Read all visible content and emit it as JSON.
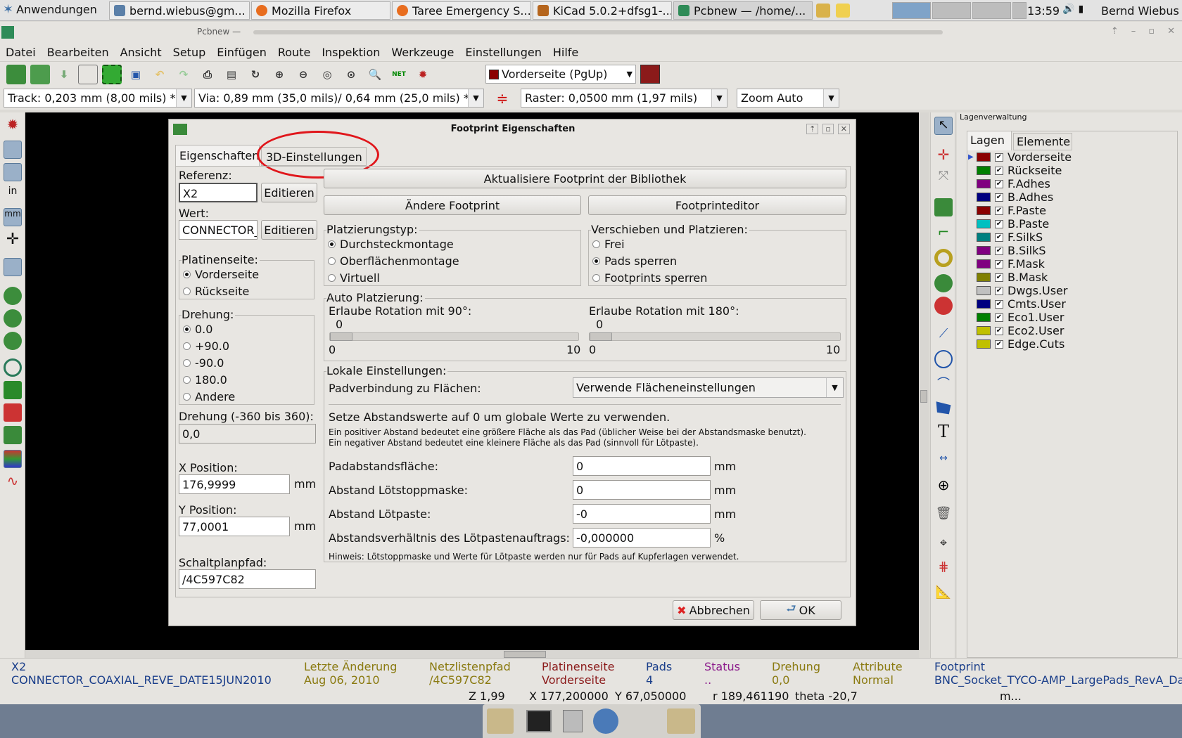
{
  "taskbar": {
    "apps_label": "Anwendungen",
    "tasks": [
      "bernd.wiebus@gm...",
      "Mozilla Firefox",
      "Taree Emergency S...",
      "KiCad 5.0.2+dfsg1-...",
      "Pcbnew — /home/..."
    ],
    "clock": "13:59",
    "user": "Bernd Wiebus"
  },
  "window": {
    "title": "Pcbnew —"
  },
  "menu": [
    "Datei",
    "Bearbeiten",
    "Ansicht",
    "Setup",
    "Einfügen",
    "Route",
    "Inspektion",
    "Werkzeuge",
    "Einstellungen",
    "Hilfe"
  ],
  "toolbar": {
    "layer_select": "Vorderseite (PgUp)",
    "track": "Track: 0,203 mm (8,00 mils) *",
    "via": "Via: 0,89 mm (35,0 mils)/ 0,64 mm (25,0 mils) *",
    "grid": "Raster: 0,0500 mm (1,97 mils)",
    "zoom": "Zoom Auto"
  },
  "left_toolbar": {
    "in_label": "in",
    "mm_label": "mm"
  },
  "layer_manager": {
    "title": "Lagenverwaltung",
    "tabs": [
      "Lagen",
      "Elemente"
    ],
    "layers": [
      {
        "name": "Vorderseite",
        "color": "#8b0000"
      },
      {
        "name": "Rückseite",
        "color": "#008000"
      },
      {
        "name": "F.Adhes",
        "color": "#800080"
      },
      {
        "name": "B.Adhes",
        "color": "#000080"
      },
      {
        "name": "F.Paste",
        "color": "#8b0000"
      },
      {
        "name": "B.Paste",
        "color": "#00c0c0"
      },
      {
        "name": "F.SilkS",
        "color": "#008080"
      },
      {
        "name": "B.SilkS",
        "color": "#800080"
      },
      {
        "name": "F.Mask",
        "color": "#800080"
      },
      {
        "name": "B.Mask",
        "color": "#808000"
      },
      {
        "name": "Dwgs.User",
        "color": "#c0c0c0"
      },
      {
        "name": "Cmts.User",
        "color": "#000080"
      },
      {
        "name": "Eco1.User",
        "color": "#008000"
      },
      {
        "name": "Eco2.User",
        "color": "#c0c000"
      },
      {
        "name": "Edge.Cuts",
        "color": "#c0c000"
      }
    ]
  },
  "dialog": {
    "title": "Footprint Eigenschaften",
    "tabs": [
      "Eigenschaften",
      "3D-Einstellungen"
    ],
    "referenz_label": "Referenz:",
    "referenz_value": "X2",
    "editieren": "Editieren",
    "wert_label": "Wert:",
    "wert_value": "CONNECTOR_",
    "platinenseite_label": "Platinenseite:",
    "platinenseite_options": [
      "Vorderseite",
      "Rückseite"
    ],
    "drehung_label": "Drehung:",
    "drehung_options": [
      "0.0",
      "+90.0",
      "-90.0",
      "180.0",
      "Andere"
    ],
    "drehung_range_label": "Drehung (-360 bis 360):",
    "drehung_value": "0,0",
    "x_label": "X Position:",
    "x_value": "176,9999",
    "y_label": "Y Position:",
    "y_value": "77,0001",
    "unit_mm": "mm",
    "schaltplan_label": "Schaltplanpfad:",
    "schaltplan_value": "/4C597C82",
    "update_button": "Aktualisiere Footprint der Bibliothek",
    "change_button": "Ändere Footprint",
    "editor_button": "Footprinteditor",
    "placement_label": "Platzierungstyp:",
    "placement_options": [
      "Durchsteckmontage",
      "Oberflächenmontage",
      "Virtuell"
    ],
    "move_label": "Verschieben und Platzieren:",
    "move_options": [
      "Frei",
      "Pads sperren",
      "Footprints sperren"
    ],
    "auto_label": "Auto Platzierung:",
    "rot90_label": "Erlaube Rotation mit 90°:",
    "rot180_label": "Erlaube Rotation mit 180°:",
    "slider_value": "0",
    "slider_min": "0",
    "slider_max": "10",
    "local_label": "Lokale Einstellungen:",
    "pad_conn_label": "Padverbindung zu Flächen:",
    "pad_conn_value": "Verwende Flächeneinstellungen",
    "clearance_title": "Setze Abstandswerte auf 0 um globale Werte zu verwenden.",
    "clearance_note1": "Ein positiver Abstand bedeutet eine größere Fläche als das Pad (üblicher Weise bei der Abstandsmaske benutzt).",
    "clearance_note2": "Ein negativer Abstand bedeutet eine kleinere Fläche als das Pad (sinnvoll für Lötpaste).",
    "pad_clear_label": "Padabstandsfläche:",
    "pad_clear_value": "0",
    "mask_label": "Abstand Lötstoppmaske:",
    "mask_value": "0",
    "paste_label": "Abstand Lötpaste:",
    "paste_value": "-0",
    "ratio_label": "Abstandsverhältnis des Lötpastenauftrags:",
    "ratio_value": "-0,000000",
    "percent": "%",
    "hint": "Hinweis: Lötstoppmaske und Werte für Lötpaste werden nur für Pads auf Kupferlagen verwendet.",
    "cancel_button": "Abbrechen",
    "ok_button": "OK"
  },
  "status": {
    "ref": "X2",
    "value": "CONNECTOR_COAXIAL_REVE_DATE15JUN2010",
    "last_change_label": "Letzte Änderung",
    "last_change": "Aug 06, 2010",
    "netlist_label": "Netzlistenpfad",
    "netlist": "/4C597C82",
    "side_label": "Platinenseite",
    "side": "Vorderseite",
    "pads_label": "Pads",
    "pads": "4",
    "status_label": "Status",
    "status": "..",
    "rotation_label": "Drehung",
    "rotation": "0,0",
    "attr_label": "Attribute",
    "attr": "Normal",
    "footprint_label": "Footprint",
    "footprint": "BNC_Socket_TYCO-AMP_LargePads_RevA_Da",
    "z": "Z 1,99",
    "x": "X 177,200000",
    "y": "Y 67,050000",
    "r": "r 189,461190",
    "theta": "theta -20,7",
    "units": "m..."
  }
}
